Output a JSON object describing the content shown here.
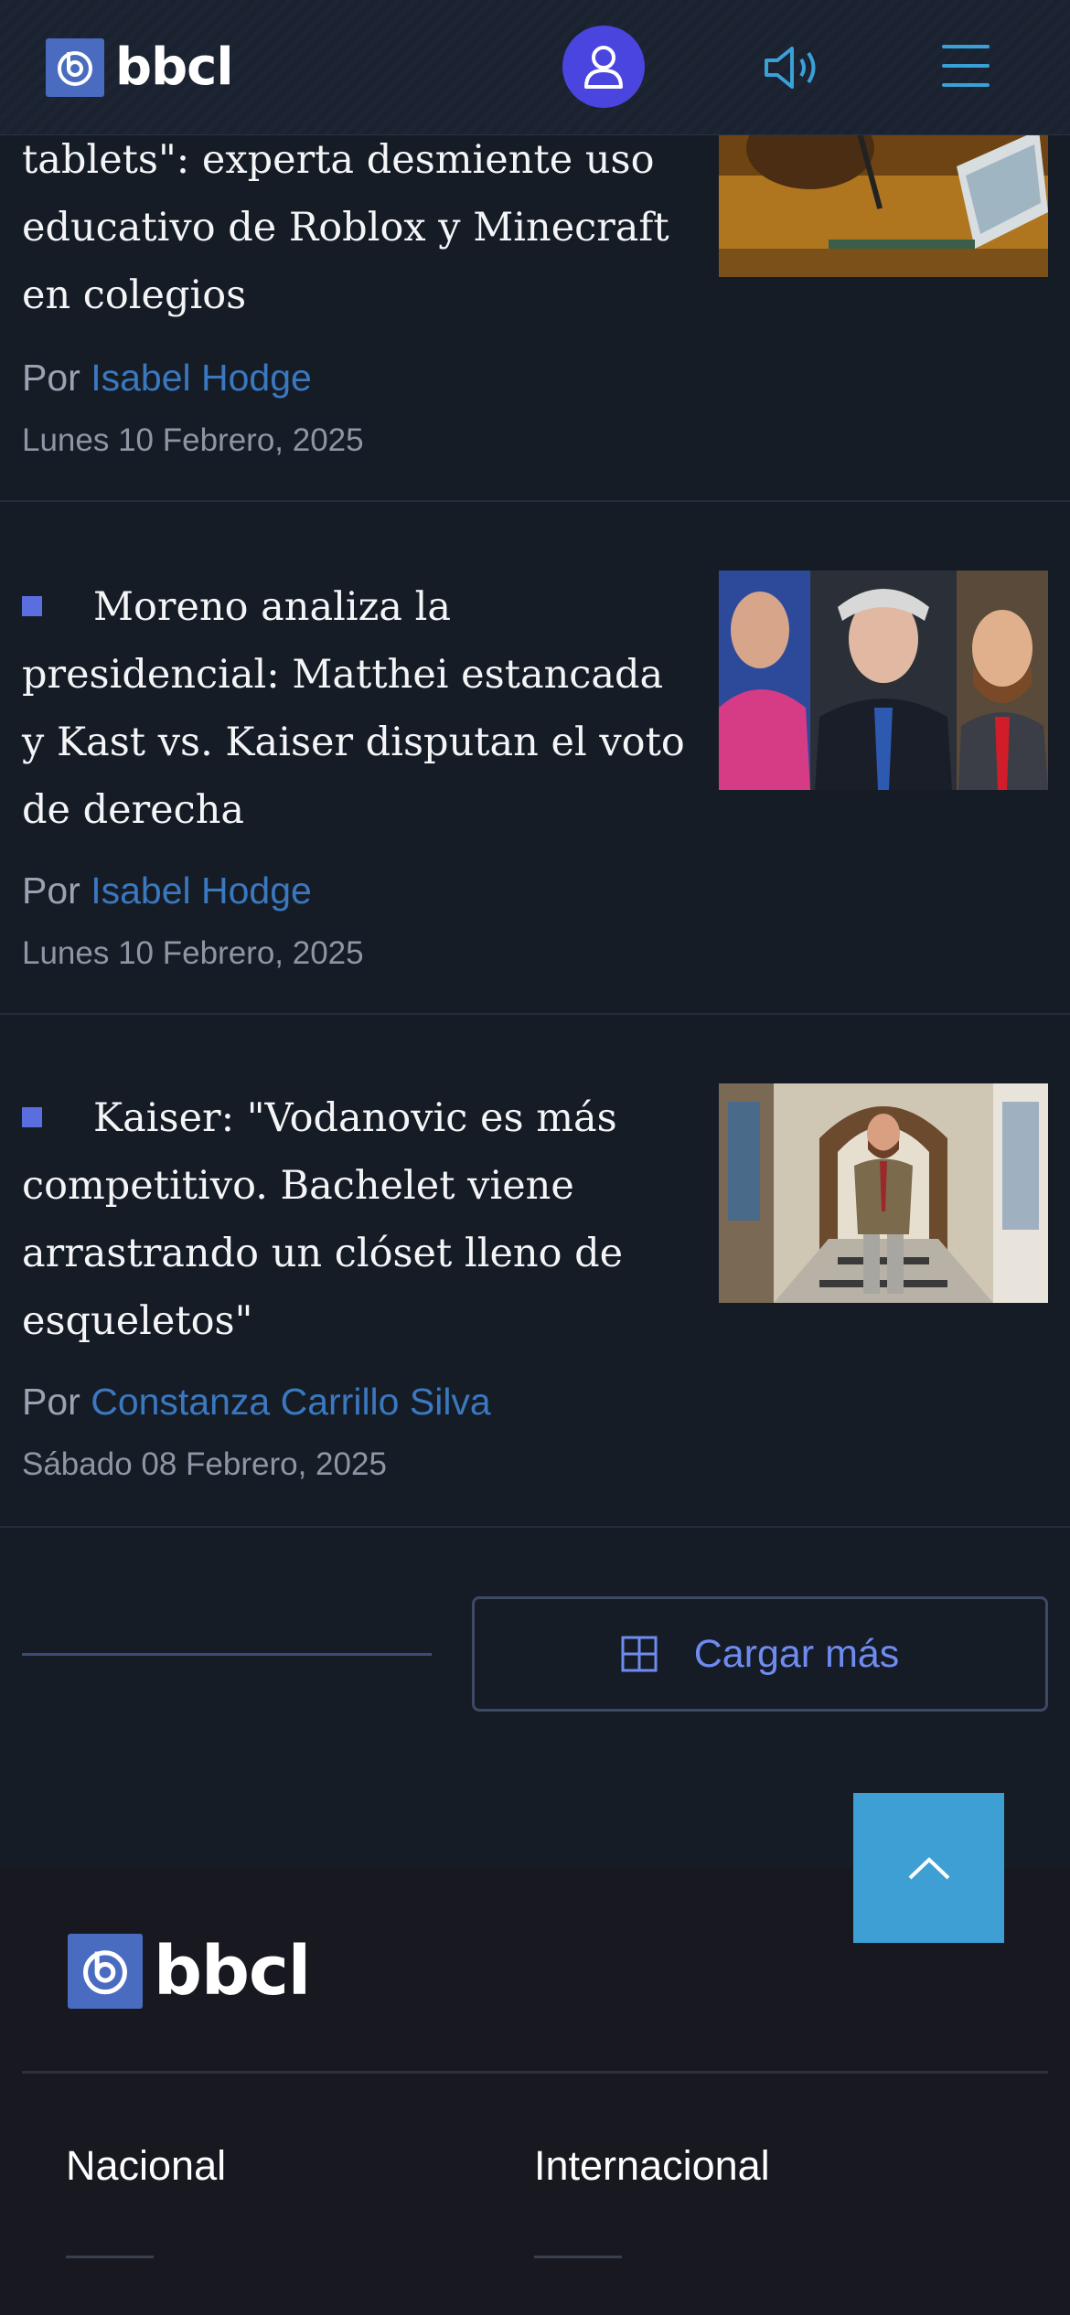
{
  "header": {
    "logo_text": "bbcl",
    "icons": {
      "user": "user-icon",
      "sound": "speaker-icon",
      "menu": "hamburger-icon"
    }
  },
  "articles": [
    {
      "title": "tablets\": experta desmiente uso educativo de Roblox y Minecraft en colegios",
      "by_prefix": "Por",
      "author": "Isabel Hodge",
      "date": "Lunes 10 Febrero, 2025"
    },
    {
      "title": "Moreno analiza la presidencial: Matthei estancada y Kast vs. Kaiser disputan el voto de derecha",
      "by_prefix": "Por",
      "author": "Isabel Hodge",
      "date": "Lunes 10 Febrero, 2025"
    },
    {
      "title": "Kaiser: \"Vodanovic es más competitivo. Bachelet viene arrastrando un clóset lleno de esqueletos\"",
      "by_prefix": "Por",
      "author": "Constanza Carrillo Silva",
      "date": "Sábado 08 Febrero, 2025"
    }
  ],
  "load_more": {
    "label": "Cargar más",
    "icon": "plus-square-icon"
  },
  "back_to_top": {
    "icon": "chevron-up-icon"
  },
  "footer": {
    "logo_text": "bbcl",
    "sections": [
      "Nacional",
      "Internacional"
    ]
  },
  "colors": {
    "background": "#161c26",
    "accent_blue": "#4b45e0",
    "link_blue": "#3a78c0",
    "button_blue": "#3d9fd4",
    "footer_bg": "#181920"
  }
}
